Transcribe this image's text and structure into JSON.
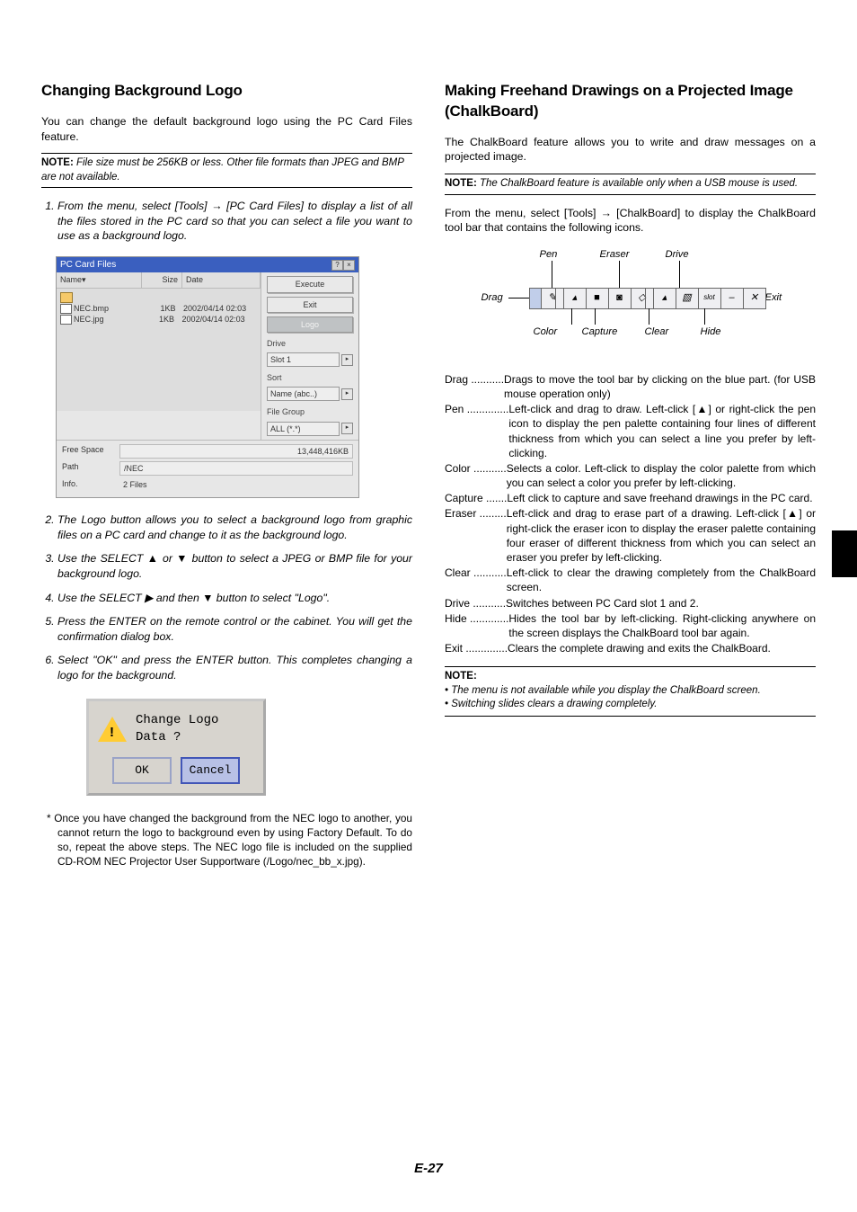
{
  "page_number": "E-27",
  "left": {
    "h1": "Changing Background Logo",
    "intro": "You can change the default background logo using the PC Card Files feature.",
    "note_bold": "NOTE:",
    "note": " File size must be 256KB or less. Other file formats than JPEG and BMP are not available.",
    "steps": [
      "From the menu, select [Tools] → [PC Card Files] to display a list of all the files stored in the PC card so that you can select a file you want to use as a background logo.",
      "The Logo button allows you to select a background logo from graphic files on a PC card and change to it as the background logo.",
      "Use the SELECT ▲ or ▼ button to select a JPEG or BMP file for your background logo.",
      "Use the SELECT ▶ and then ▼ button to select \"Logo\".",
      "Press the ENTER on the remote control or the cabinet. You will get the confirmation dialog box.",
      "Select \"OK\" and press the ENTER button. This completes changing a logo for the background."
    ],
    "win": {
      "title": "PC Card Files",
      "columns": {
        "name": "Name▾",
        "size": "Size",
        "date": "Date"
      },
      "files": [
        {
          "name": "NEC.bmp",
          "size": "1KB",
          "date": "2002/04/14 02:03"
        },
        {
          "name": "NEC.jpg",
          "size": "1KB",
          "date": "2002/04/14 02:03"
        }
      ],
      "buttons": {
        "execute": "Execute",
        "exit": "Exit",
        "logo": "Logo"
      },
      "drive_label": "Drive",
      "drive_value": "Slot 1",
      "sort_label": "Sort",
      "sort_value": "Name (abc..)",
      "fg_label": "File Group",
      "fg_value": "ALL (*.*)",
      "footer": {
        "free_space_label": "Free Space",
        "free_space_value": "13,448,416KB",
        "path_label": "Path",
        "path_value": "/NEC",
        "info_label": "Info.",
        "info_value": "2 Files"
      },
      "close_q": "?",
      "close_x": "×"
    },
    "dialog": {
      "text": "Change Logo Data ?",
      "ok": "OK",
      "cancel": "Cancel"
    },
    "footnote": "*   Once you have changed the background from the NEC logo to another, you cannot return the logo to background even by using Factory Default. To do so, repeat the above steps. The NEC logo file is included on the supplied CD-ROM NEC Projector User Supportware (/Logo/nec_bb_x.jpg)."
  },
  "right": {
    "h1": "Making Freehand Drawings on a Projected Image (ChalkBoard)",
    "intro": "The ChalkBoard feature allows you to write and draw messages on a projected image.",
    "note_bold": "NOTE:",
    "note": " The ChalkBoard feature is available only when a USB mouse is used.",
    "para2": "From the menu, select [Tools] → [ChalkBoard] to display the ChalkBoard tool bar that contains the following icons.",
    "labels": {
      "pen": "Pen",
      "eraser": "Eraser",
      "drive": "Drive",
      "drag": "Drag",
      "exit": "Exit",
      "color": "Color",
      "capture": "Capture",
      "clear": "Clear",
      "hide": "Hide"
    },
    "icons": {
      "pen": "✎",
      "color": "■",
      "capture": "◙",
      "eraser": "◇",
      "clear": "▧",
      "drive": "1",
      "hide": "–",
      "exit": "✕",
      "dd": "▴"
    },
    "defs": [
      {
        "term": "Drag",
        "dots": " ........... ",
        "def": "Drags to move the tool bar by clicking on the blue part. (for USB mouse operation only)"
      },
      {
        "term": "Pen",
        "dots": " .............. ",
        "def": "Left-click and drag to draw. Left-click [▲] or right-click the pen icon to display the pen palette containing four lines of different thickness from which you can select a line you prefer by left-clicking."
      },
      {
        "term": "Color",
        "dots": " ........... ",
        "def": "Selects a color. Left-click to display the color palette from which you can select a color you prefer by left-clicking."
      },
      {
        "term": "Capture",
        "dots": " ....... ",
        "def": "Left click to capture and save freehand drawings in the PC card."
      },
      {
        "term": "Eraser",
        "dots": " ......... ",
        "def": "Left-click and drag to erase part of a drawing. Left-click [▲] or right-click the eraser icon to display the eraser palette containing four eraser of different thickness from which you can select an eraser you prefer by left-clicking."
      },
      {
        "term": "Clear",
        "dots": " ........... ",
        "def": "Left-click to clear the drawing completely from the ChalkBoard screen."
      },
      {
        "term": "Drive",
        "dots": " ........... ",
        "def": "Switches between PC Card slot 1 and 2."
      },
      {
        "term": "Hide",
        "dots": " ............. ",
        "def": "Hides the tool bar by left-clicking. Right-clicking anywhere on the screen displays the ChalkBoard tool bar again."
      },
      {
        "term": "Exit",
        "dots": " .............. ",
        "def": "Clears the complete drawing and exits the ChalkBoard."
      }
    ],
    "note2_head_bold": "NOTE:",
    "note2_items": [
      "• The menu is not available while you display the ChalkBoard screen.",
      "• Switching slides clears a drawing completely."
    ]
  }
}
